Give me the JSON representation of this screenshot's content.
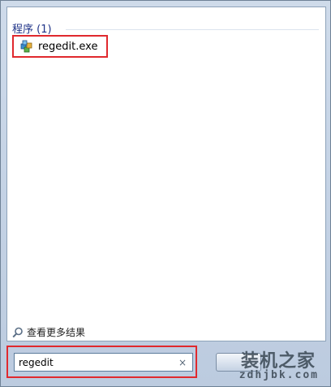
{
  "results": {
    "section_title": "程序 (1)",
    "items": [
      {
        "label": "regedit.exe",
        "icon": "registry-editor-icon"
      }
    ]
  },
  "more_results": {
    "label": "查看更多结果",
    "icon": "search-icon"
  },
  "search": {
    "value": "regedit",
    "clear_label": "×"
  },
  "watermark": {
    "text": "装机之家",
    "url": "zdhjbk.com"
  },
  "colors": {
    "highlight": "#e0292e",
    "section_title": "#1e3287"
  }
}
